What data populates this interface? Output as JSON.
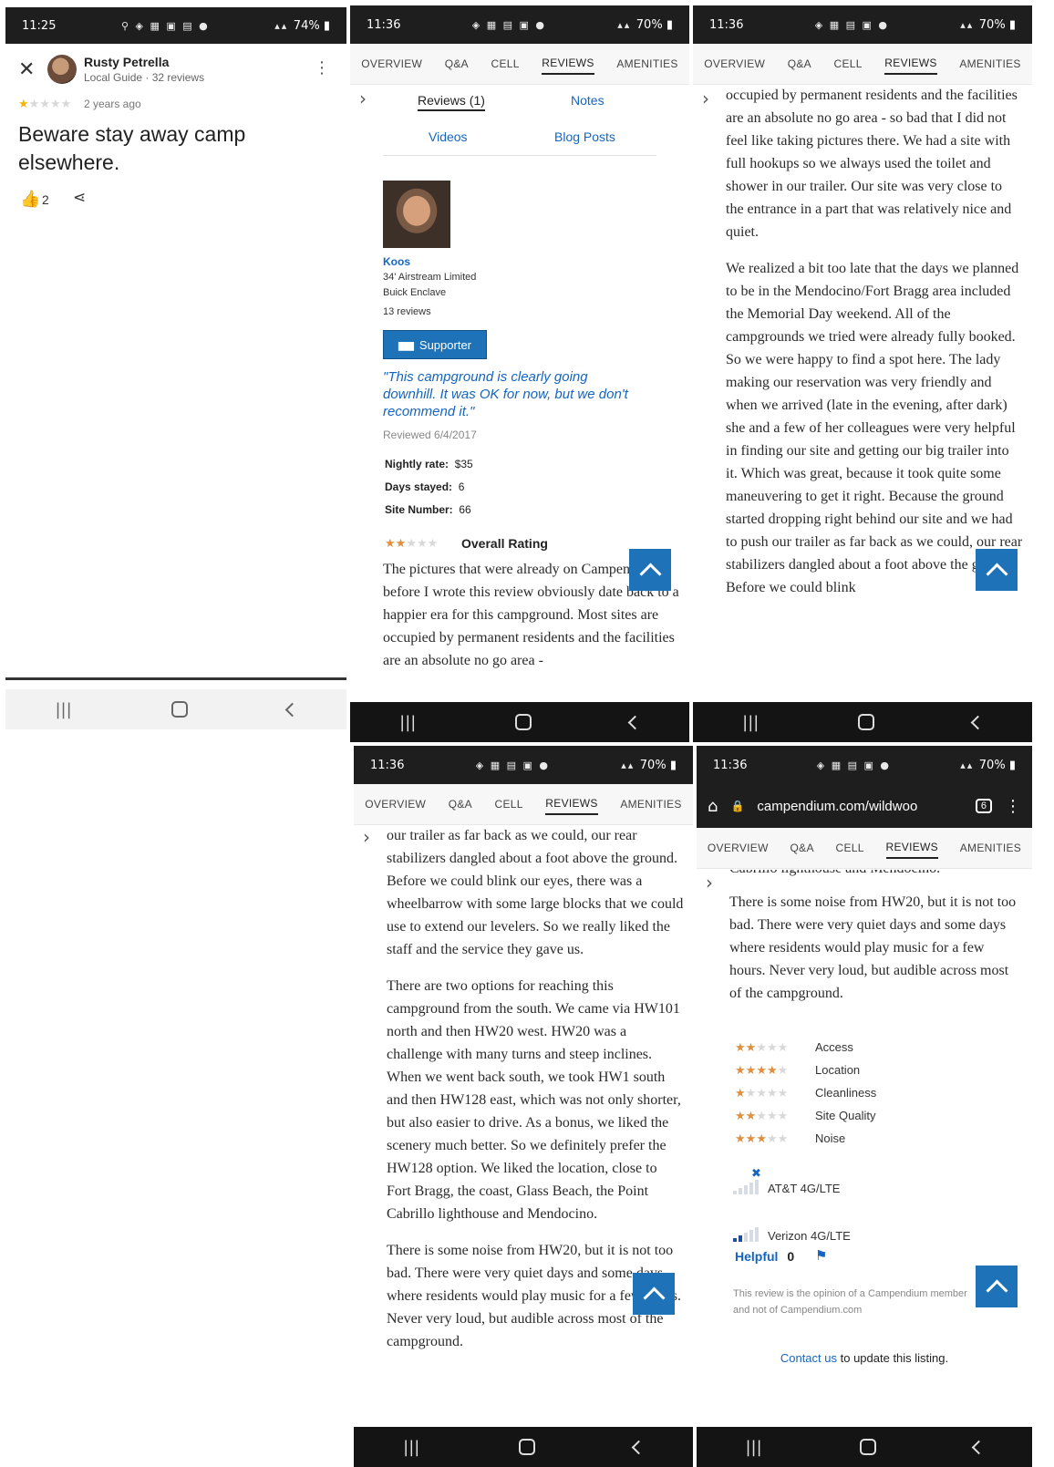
{
  "colors": {
    "accent_blue": "#1e73b8",
    "quote_blue": "#1565c0",
    "star_orange": "#e08f3c",
    "star_gold": "#f4b400",
    "status_bar": "#1e1e1e"
  },
  "icons": {
    "signal": "signal-icon",
    "battery": "battery-icon",
    "close": "close-icon",
    "more": "more-vert-icon",
    "thumbs_up": "thumbs-up-icon",
    "share": "share-icon",
    "expand": "chevron-right-icon",
    "back_to_top": "chevron-up-icon",
    "home": "home-icon",
    "lock": "lock-icon",
    "flag": "flag-icon",
    "no_signal": "x-icon"
  },
  "google_panel": {
    "time": "11:25",
    "battery": "74%",
    "reviewer_name": "Rusty Petrella",
    "reviewer_meta": "Local Guide · 32 reviews",
    "rating": 1,
    "rating_max": 5,
    "date": "2 years ago",
    "review_text": "Beware stay away camp elsewhere.",
    "likes": "2"
  },
  "campendium": {
    "time": "11:36",
    "battery": "70%",
    "tabs": [
      "OVERVIEW",
      "Q&A",
      "CELL",
      "REVIEWS",
      "AMENITIES"
    ],
    "active_tab": "REVIEWS",
    "subtabs": [
      "Reviews (1)",
      "Notes",
      "Videos",
      "Blog Posts"
    ],
    "reviewer": {
      "name": "Koos",
      "rig_line1": "34' Airstream Limited",
      "rig_line2": "Buick Enclave",
      "review_count": "13 reviews",
      "badge": "Supporter"
    },
    "quote": "\"This campground is clearly going downhill. It was OK for now, but we don't recommend it.\"",
    "reviewed_date": "Reviewed 6/4/2017",
    "stats": [
      {
        "label": "Nightly rate:",
        "value": "$35"
      },
      {
        "label": "Days stayed:",
        "value": "6"
      },
      {
        "label": "Site Number:",
        "value": "66"
      }
    ],
    "overall_label": "Overall Rating",
    "overall_rating": 2,
    "url": "campendium.com/wildwoo",
    "tab_count": "6",
    "panel2_text": "The pictures that were already on Campendium before I wrote this review obviously date back to a happier era for this campground. Most sites are occupied by permanent residents and the facilities are an absolute no go area -",
    "panel3_paras": [
      "occupied by permanent residents and the facilities are an absolute no go area - so bad that I did not feel like taking pictures there. We had a site with full hookups so we always used the toilet and shower in our trailer. Our site was very close to the entrance in a part that was relatively nice and quiet.",
      "We realized a bit too late that the days we planned to be in the Mendocino/Fort Bragg area included the Memorial Day weekend. All of the campgrounds we tried were already fully booked. So we were happy to find a spot here. The lady making our reservation was very friendly and when we arrived (late in the evening, after dark) she and a few of her colleagues were very helpful in finding our site and getting our big trailer into it. Which was great, because it took quite some maneuvering to get it right. Because the ground started dropping right behind our site and we had to push our trailer as far back as we could, our rear stabilizers dangled about a foot above the ground. Before we could blink"
    ],
    "panel4_paras": [
      "our trailer as far back as we could, our rear stabilizers dangled about a foot above the ground. Before we could blink our eyes, there was a wheelbarrow with some large blocks that we could use to extend our levelers. So we really liked the staff and the service they gave us.",
      "There are two options for reaching this campground from the south. We came via HW101 north and then HW20 west. HW20 was a challenge with many turns and steep inclines. When we went back south, we took HW1 south and then HW128 east, which was not only shorter, but also easier to drive. As a bonus, we liked the scenery much better. So we definitely prefer the HW128 option. We liked the location, close to Fort Bragg, the coast, Glass Beach, the Point Cabrillo lighthouse and Mendocino.",
      "There is some noise from HW20, but it is not too bad. There were very quiet days and some days where residents would play music for a few hours. Never very loud, but audible across most of the campground."
    ],
    "panel5_cut_text": "Cabrillo lighthouse and Mendocino.",
    "panel5_para": "There is some noise from HW20, but it is not too bad. There were very quiet days and some days where residents would play music for a few hours. Never very loud, but audible across most of the campground.",
    "ratings": [
      {
        "label": "Access",
        "stars": 2
      },
      {
        "label": "Location",
        "stars": 4
      },
      {
        "label": "Cleanliness",
        "stars": 1
      },
      {
        "label": "Site Quality",
        "stars": 2
      },
      {
        "label": "Noise",
        "stars": 3
      }
    ],
    "cell": [
      {
        "carrier": "AT&T 4G/LTE",
        "bars": 0
      },
      {
        "carrier": "Verizon 4G/LTE",
        "bars": 2
      }
    ],
    "helpful_label": "Helpful",
    "helpful_count": "0",
    "disclaimer": "This review is the opinion of a Campendium member and not of Campendium.com",
    "contact_link": "Contact us",
    "contact_rest": " to update this listing."
  }
}
